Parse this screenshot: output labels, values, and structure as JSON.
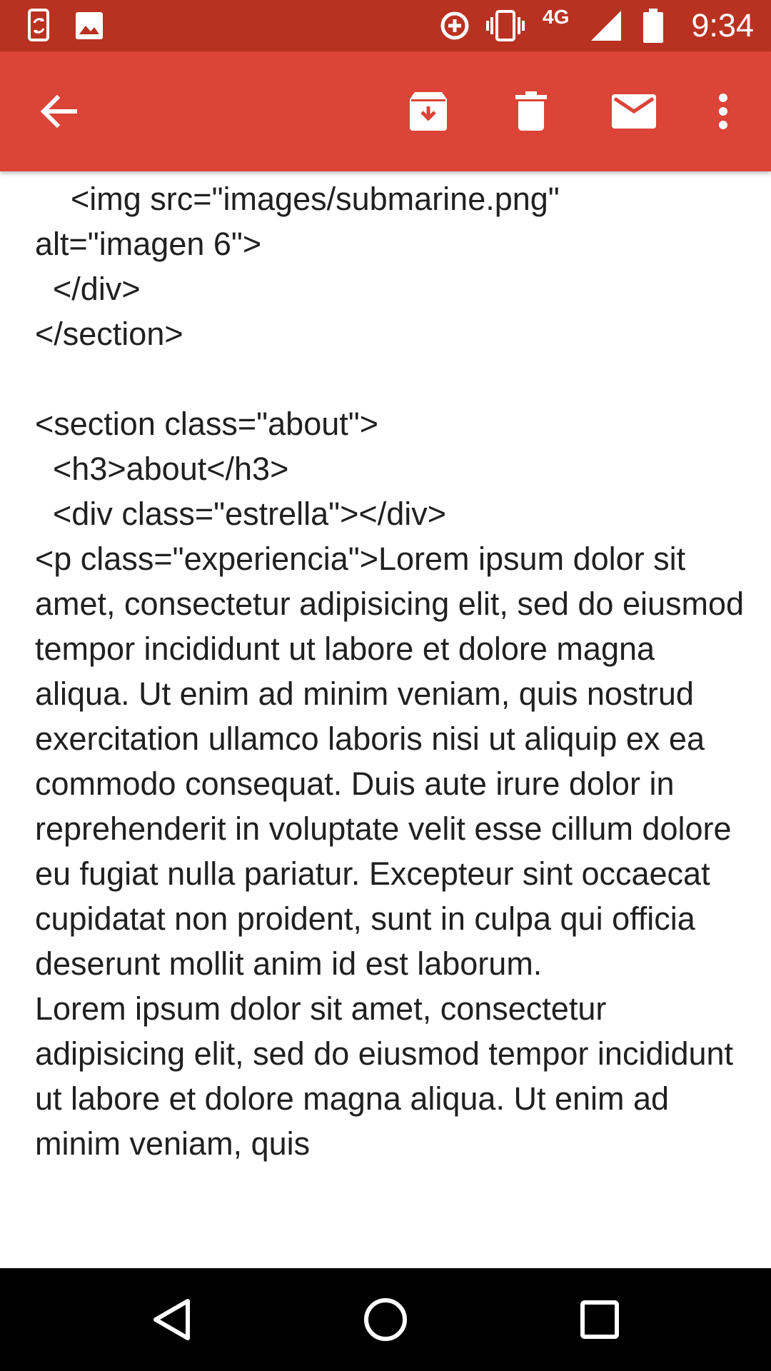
{
  "status_bar": {
    "time": "9:34",
    "network": "4G",
    "icons": [
      "sync-phone-icon",
      "image-icon",
      "data-saver-icon",
      "vibrate-icon",
      "signal-icon",
      "battery-icon"
    ]
  },
  "toolbar": {
    "icons": [
      "back-arrow-icon",
      "archive-icon",
      "delete-icon",
      "mark-unread-icon",
      "more-vert-icon"
    ]
  },
  "email": {
    "body": "  ...\n    <img src=\"images/submarine.png\"\nalt=\"imagen 6\">\n  </div>\n</section>\n\n<section class=\"about\">\n  <h3>about</h3>\n  <div class=\"estrella\"></div>\n<p class=\"experiencia\">Lorem ipsum dolor sit amet, consectetur adipisicing elit, sed do eiusmod tempor incididunt ut labore et dolore magna aliqua. Ut enim ad minim veniam, quis nostrud exercitation ullamco laboris nisi ut aliquip ex ea commodo consequat. Duis aute irure dolor in reprehenderit in voluptate velit esse cillum dolore eu fugiat nulla pariatur. Excepteur sint occaecat cupidatat non proident, sunt in culpa qui officia deserunt mollit anim id est laborum.\nLorem ipsum dolor sit amet, consectetur adipisicing elit, sed do eiusmod tempor incididunt ut labore et dolore magna aliqua. Ut enim ad minim veniam, quis"
  },
  "nav_bar": {
    "icons": [
      "back-triangle-icon",
      "home-circle-icon",
      "recents-square-icon"
    ]
  },
  "colors": {
    "status_bar": "#b93221",
    "toolbar": "#db4437",
    "nav_bar": "#000000",
    "text": "#202020"
  }
}
